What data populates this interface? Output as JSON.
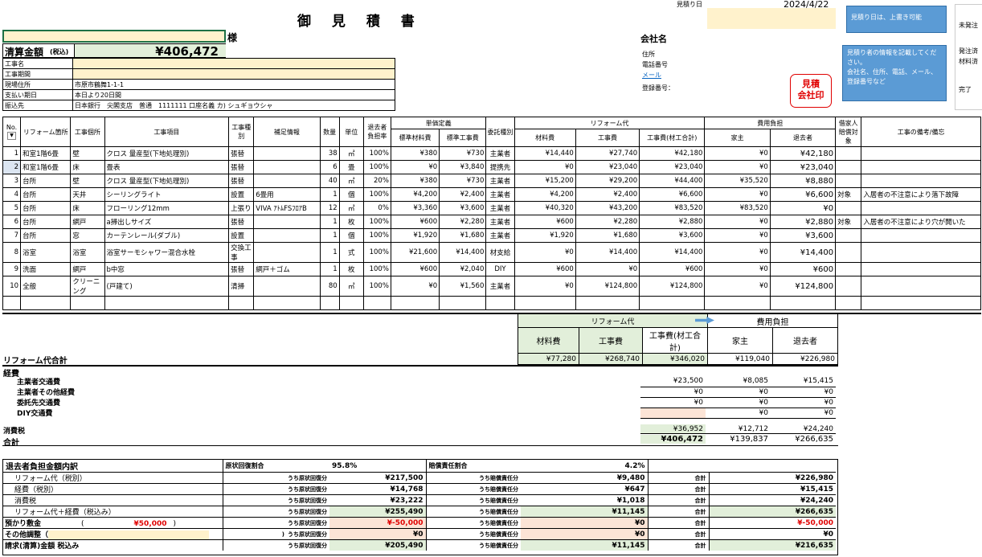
{
  "header": {
    "title": "御 見 積 書",
    "estimate_date_label": "見積り日",
    "estimate_date": "2024/4/22",
    "honorific": "様",
    "company_name_label": "会社名",
    "address_label": "住所",
    "phone_label": "電話番号",
    "email_label": "メール",
    "registration_label": "登録番号：",
    "stamp_text_1": "見積",
    "stamp_text_2": "会社印"
  },
  "notes": {
    "date_note": "見積り日は、上書き可能",
    "company_note": "見積り者の情報を記載してください。\n会社名、住所、電話、メール、登録番号など",
    "status_1": "未発注",
    "status_2": "発注済",
    "status_3": "材料済",
    "status_4": "完了"
  },
  "summary": {
    "total_label": "清算金額",
    "total_label_suffix": "(税込)",
    "total_value": "¥406,472",
    "rows": [
      {
        "label": "工事名",
        "value": ""
      },
      {
        "label": "工事期間",
        "value": ""
      },
      {
        "label": "現場住所",
        "value": "市原市鶴舞1-1-1"
      },
      {
        "label": "支払い期日",
        "value": "本日より20日間"
      },
      {
        "label": "振込先",
        "value": "日本銀行　尖閣支店　普通　1111111 口座名義 カ) シュギョウシャ"
      }
    ]
  },
  "table": {
    "headers": {
      "no": "No.",
      "location": "リフォーム箇所",
      "part": "工事個所",
      "item": "工事項目",
      "type": "工事種別",
      "extra": "補足情報",
      "qty": "数量",
      "unit": "単位",
      "ratio": "退去者負担率",
      "unit_price_group": "単価定義",
      "std_material": "標準材料費",
      "std_labor": "標準工事費",
      "commission": "委託種別",
      "reform_group": "リフォーム代",
      "material": "材料費",
      "labor": "工事費",
      "labor_total": "工事費(材工合計)",
      "burden_group": "費用負担",
      "owner": "家主",
      "tenant": "退去者",
      "insurance": "借家人賠償対象",
      "remarks": "工事の備考/備忘"
    },
    "rows": [
      {
        "no": "1",
        "loc": "和室1階6畳",
        "part": "壁",
        "item": "クロス 量産型(下地処理別)",
        "type": "張替",
        "extra": "",
        "qty": "38",
        "unit": "㎡",
        "ratio": "100%",
        "smat": "¥380",
        "slab": "¥730",
        "com": "主業者",
        "mat": "¥14,440",
        "lab": "¥27,740",
        "tot": "¥42,180",
        "own": "¥0",
        "ten": "¥42,180",
        "ins": "",
        "rem": ""
      },
      {
        "no": "2",
        "loc": "和室1階6畳",
        "part": "床",
        "item": "畳表",
        "type": "張替",
        "extra": "",
        "qty": "6",
        "unit": "畳",
        "ratio": "100%",
        "smat": "¥0",
        "slab": "¥3,840",
        "com": "提携先",
        "mat": "¥0",
        "lab": "¥23,040",
        "tot": "¥23,040",
        "own": "¥0",
        "ten": "¥23,040",
        "ins": "",
        "rem": ""
      },
      {
        "no": "3",
        "loc": "台所",
        "part": "壁",
        "item": "クロス 量産型(下地処理別)",
        "type": "張替",
        "extra": "",
        "qty": "40",
        "unit": "㎡",
        "ratio": "20%",
        "smat": "¥380",
        "slab": "¥730",
        "com": "主業者",
        "mat": "¥15,200",
        "lab": "¥29,200",
        "tot": "¥44,400",
        "own": "¥35,520",
        "ten": "¥8,880",
        "ins": "",
        "rem": ""
      },
      {
        "no": "4",
        "loc": "台所",
        "part": "天井",
        "item": "シーリングライト",
        "type": "設置",
        "extra": "6畳用",
        "qty": "1",
        "unit": "個",
        "ratio": "100%",
        "smat": "¥4,200",
        "slab": "¥2,400",
        "com": "主業者",
        "mat": "¥4,200",
        "lab": "¥2,400",
        "tot": "¥6,600",
        "own": "¥0",
        "ten": "¥6,600",
        "ins": "対象",
        "rem": "入居者の不注意により落下故障"
      },
      {
        "no": "5",
        "loc": "台所",
        "part": "床",
        "item": "フローリング12mm",
        "type": "上張り",
        "extra": "VIVA ｱﾄﾑFSﾌﾛｱB",
        "qty": "12",
        "unit": "㎡",
        "ratio": "0%",
        "smat": "¥3,360",
        "slab": "¥3,600",
        "com": "主業者",
        "mat": "¥40,320",
        "lab": "¥43,200",
        "tot": "¥83,520",
        "own": "¥83,520",
        "ten": "¥0",
        "ins": "",
        "rem": ""
      },
      {
        "no": "6",
        "loc": "台所",
        "part": "網戸",
        "item": "a掃出しサイズ",
        "type": "張替",
        "extra": "",
        "qty": "1",
        "unit": "枚",
        "ratio": "100%",
        "smat": "¥600",
        "slab": "¥2,280",
        "com": "主業者",
        "mat": "¥600",
        "lab": "¥2,280",
        "tot": "¥2,880",
        "own": "¥0",
        "ten": "¥2,880",
        "ins": "対象",
        "rem": "入居者の不注意により穴が開いた"
      },
      {
        "no": "7",
        "loc": "台所",
        "part": "窓",
        "item": "カーテンレール(ダブル)",
        "type": "設置",
        "extra": "",
        "qty": "1",
        "unit": "個",
        "ratio": "100%",
        "smat": "¥1,920",
        "slab": "¥1,680",
        "com": "主業者",
        "mat": "¥1,920",
        "lab": "¥1,680",
        "tot": "¥3,600",
        "own": "¥0",
        "ten": "¥3,600",
        "ins": "",
        "rem": ""
      },
      {
        "no": "8",
        "loc": "浴室",
        "part": "浴室",
        "item": "浴室サーモシャワー混合水栓",
        "type": "交換工事",
        "extra": "",
        "qty": "1",
        "unit": "式",
        "ratio": "100%",
        "smat": "¥21,600",
        "slab": "¥14,400",
        "com": "材支給",
        "mat": "¥0",
        "lab": "¥14,400",
        "tot": "¥14,400",
        "own": "¥0",
        "ten": "¥14,400",
        "ins": "",
        "rem": ""
      },
      {
        "no": "9",
        "loc": "洗面",
        "part": "網戸",
        "item": "b中窓",
        "type": "張替",
        "extra": "網戸＋ゴム",
        "qty": "1",
        "unit": "枚",
        "ratio": "100%",
        "smat": "¥600",
        "slab": "¥2,040",
        "com": "DIY",
        "mat": "¥600",
        "lab": "¥0",
        "tot": "¥600",
        "own": "¥0",
        "ten": "¥600",
        "ins": "",
        "rem": ""
      },
      {
        "no": "10",
        "loc": "全般",
        "part": "クリーニング",
        "item": "(戸建て)",
        "type": "清掃",
        "extra": "",
        "qty": "80",
        "unit": "㎡",
        "ratio": "100%",
        "smat": "¥0",
        "slab": "¥1,560",
        "com": "主業者",
        "mat": "¥0",
        "lab": "¥124,800",
        "tot": "¥124,800",
        "own": "¥0",
        "ten": "¥124,800",
        "ins": "",
        "rem": ""
      }
    ]
  },
  "totals": {
    "reform_label": "リフォーム代",
    "burden_label": "費用負担",
    "material": "材料費",
    "labor": "工事費",
    "labor_total": "工事費(材工合計)",
    "owner": "家主",
    "tenant": "退去者",
    "reform_total_label": "リフォーム代合計",
    "reform_total": {
      "mat": "¥77,280",
      "lab": "¥268,740",
      "tot": "¥346,020",
      "own": "¥119,040",
      "ten": "¥226,980"
    },
    "expenses_label": "経費",
    "expenses": [
      {
        "label": "主業者交通費",
        "tot": "¥23,500",
        "own": "¥8,085",
        "ten": "¥15,415"
      },
      {
        "label": "主業者その他経費",
        "tot": "¥0",
        "own": "¥0",
        "ten": "¥0"
      },
      {
        "label": "委託先交通費",
        "tot": "¥0",
        "own": "¥0",
        "ten": "¥0"
      },
      {
        "label": "DIY交通費",
        "tot": "",
        "own": "¥0",
        "ten": "¥0"
      }
    ],
    "tax_label": "消費税",
    "tax": {
      "tot": "¥36,952",
      "own": "¥12,712",
      "ten": "¥24,240"
    },
    "grand_label": "合計",
    "grand": {
      "tot": "¥406,472",
      "own": "¥139,837",
      "ten": "¥266,635"
    }
  },
  "breakdown": {
    "title": "退去者負担金額内訳",
    "restore_ratio_label": "原状回復割合",
    "restore_ratio": "95.8%",
    "liability_ratio_label": "賠償責任割合",
    "liability_ratio": "4.2%",
    "restore_col": "うち原状回復分",
    "liability_col": "うち賠償責任分",
    "total_col": "合計",
    "deposit_open": "(",
    "deposit_close": ")",
    "other_close": ")",
    "rows": [
      {
        "label": "リフォーム代（税別）",
        "rest": "¥217,500",
        "liab": "¥9,480",
        "total": "¥226,980"
      },
      {
        "label": "経費（税別）",
        "rest": "¥14,768",
        "liab": "¥647",
        "total": "¥15,415"
      },
      {
        "label": "消費税",
        "rest": "¥23,222",
        "liab": "¥1,018",
        "total": "¥24,240"
      },
      {
        "label": "リフォーム代＋経費（税込み）",
        "rest": "¥255,490",
        "liab": "¥11,145",
        "total": "¥266,635"
      },
      {
        "label": "預かり敷金",
        "deposit": "¥50,000",
        "rest": "¥-50,000",
        "liab": "¥0",
        "total": "¥-50,000"
      },
      {
        "label": "その他調整（",
        "rest": "¥0",
        "liab": "¥0",
        "total": "¥0"
      },
      {
        "label": "請求(清算)金額 税込み",
        "rest": "¥205,490",
        "liab": "¥11,145",
        "total": "¥216,635"
      }
    ]
  }
}
